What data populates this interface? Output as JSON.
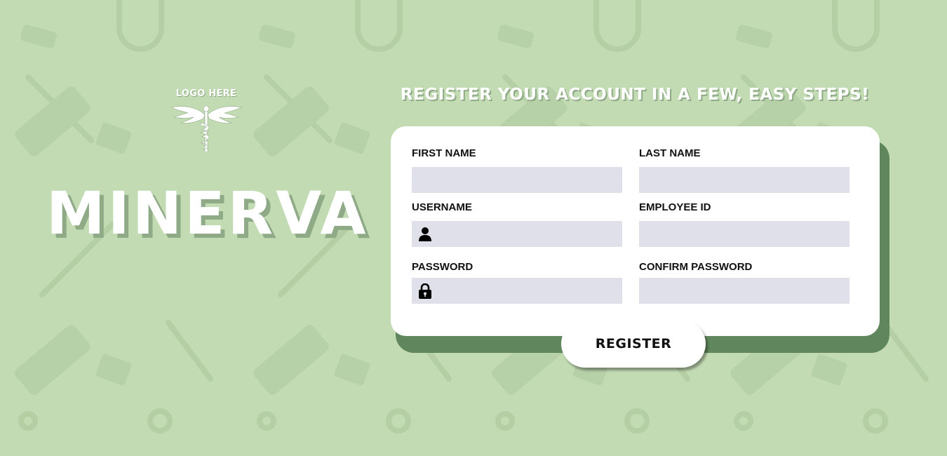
{
  "logo": {
    "text": "LOGO HERE",
    "icon": "caduceus-icon"
  },
  "brand": {
    "title": "MINERVA"
  },
  "headline": "REGISTER YOUR ACCOUNT IN A FEW, EASY STEPS!",
  "form": {
    "first_name": {
      "label": "FIRST NAME",
      "value": ""
    },
    "last_name": {
      "label": "LAST NAME",
      "value": ""
    },
    "username": {
      "label": "USERNAME",
      "value": "",
      "icon": "user-icon"
    },
    "employee_id": {
      "label": "EMPLOYEE ID",
      "value": ""
    },
    "password": {
      "label": "PASSWORD",
      "value": "",
      "icon": "lock-icon"
    },
    "confirm_password": {
      "label": "CONFIRM PASSWORD",
      "value": ""
    },
    "submit_label": "REGISTER"
  },
  "colors": {
    "background": "#c3dbb3",
    "card": "#ffffff",
    "card_shadow": "#5f865c",
    "input_fill": "#dfe0ea",
    "text_shadow": "#8eaa86"
  }
}
